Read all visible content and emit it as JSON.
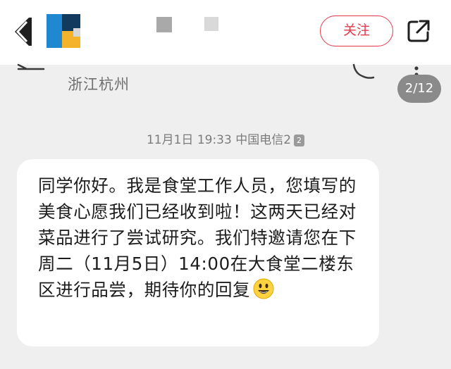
{
  "header": {
    "follow_label": "关注",
    "icons": {
      "back": "back-chevron-icon",
      "share": "share-external-icon",
      "avatar": "user-avatar",
      "username": "blurred-username"
    },
    "colors": {
      "follow_accent": "#e4394b",
      "avatar_blue": "#1f88d0",
      "avatar_yellow": "#f4b32a",
      "avatar_navy": "#123a5e"
    }
  },
  "sms_screen": {
    "location": "浙江杭州",
    "page_counter": "2/12",
    "timestamp": "11月1日 19:33 中国电信2",
    "sim_badge": "2",
    "message_text": "同学你好。我是食堂工作人员，您填写的美食心愿我们已经收到啦！这两天已经对菜品进行了尝试研究。我们特邀请您在下周二（11月5日）14:00在大食堂二楼东区进行品尝，期待你的回复",
    "icons": {
      "back": "sms-back-arrow-icon",
      "phone": "phone-call-icon",
      "menu": "more-vertical-icon",
      "emoji": "smiley-emoji"
    }
  }
}
